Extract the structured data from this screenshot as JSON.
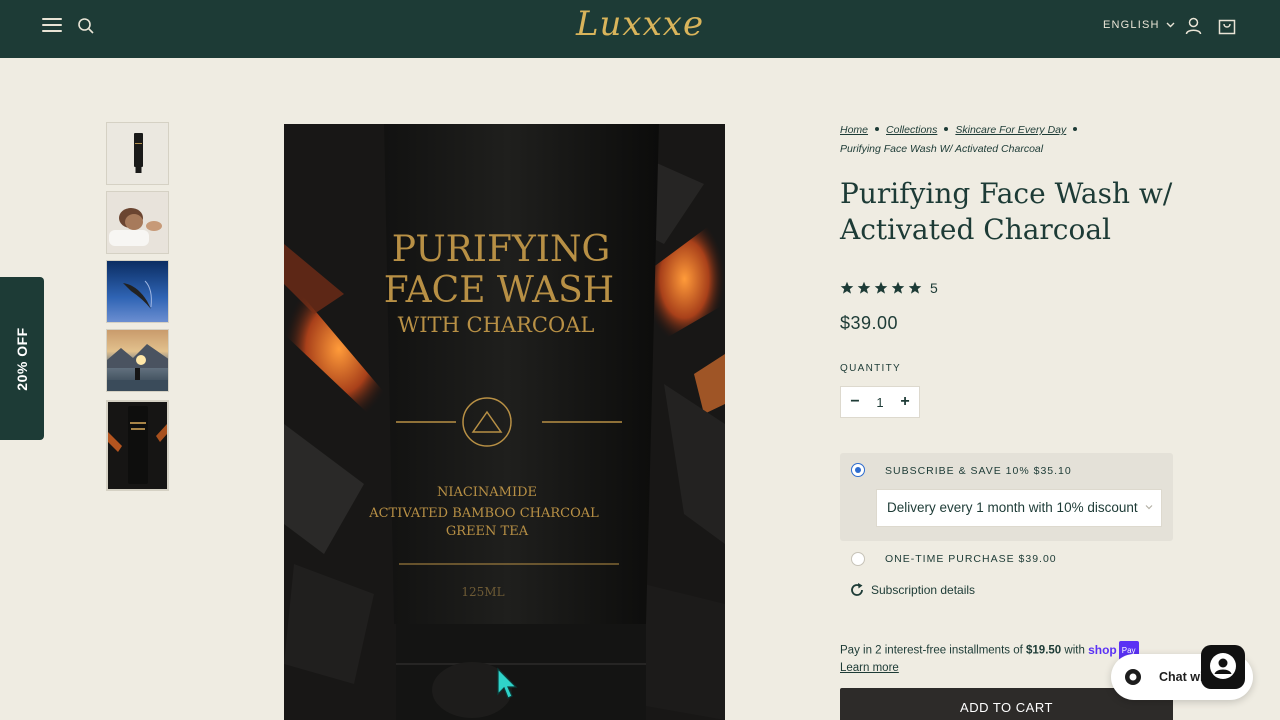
{
  "header": {
    "logo": "Luxxxe",
    "language": "ENGLISH"
  },
  "promo": {
    "label": "20% OFF"
  },
  "breadcrumb": {
    "items": [
      "Home",
      "Collections",
      "Skincare For Every Day"
    ],
    "current": "Purifying Face Wash W/ Activated Charcoal"
  },
  "product": {
    "title": "Purifying Face Wash w/ Activated Charcoal",
    "rating_count": "5",
    "rating_stars": 5,
    "price": "$39.00",
    "image_text": {
      "line1": "PURIFYING",
      "line2": "FACE WASH",
      "line3": "WITH CHARCOAL",
      "ing1": "NIACINAMIDE",
      "ing2": "ACTIVATED BAMBOO CHARCOAL",
      "ing3": "GREEN TEA",
      "volume": "125ML"
    }
  },
  "quantity": {
    "label": "QUANTITY",
    "value": "1",
    "minus": "−",
    "plus": "+"
  },
  "purchase_options": {
    "subscribe_label": "SUBSCRIBE & SAVE 10% $35.10",
    "delivery_selected": "Delivery every 1 month with 10% discount",
    "one_time_label": "ONE-TIME PURCHASE $39.00",
    "details_link": "Subscription details"
  },
  "shop_pay": {
    "prefix": "Pay in 2 interest-free installments of",
    "amount": "$19.50",
    "suffix": "with",
    "brand": "shop",
    "brand_tag": "Pay",
    "learn_more": "Learn more"
  },
  "cta": {
    "add_to_cart": "ADD TO CART"
  },
  "chat": {
    "label": "Chat with us"
  },
  "colors": {
    "brand_dark": "#1d3b36",
    "background": "#efece2",
    "gold": "#d9b45b",
    "radio_accent": "#2d6ccf"
  }
}
